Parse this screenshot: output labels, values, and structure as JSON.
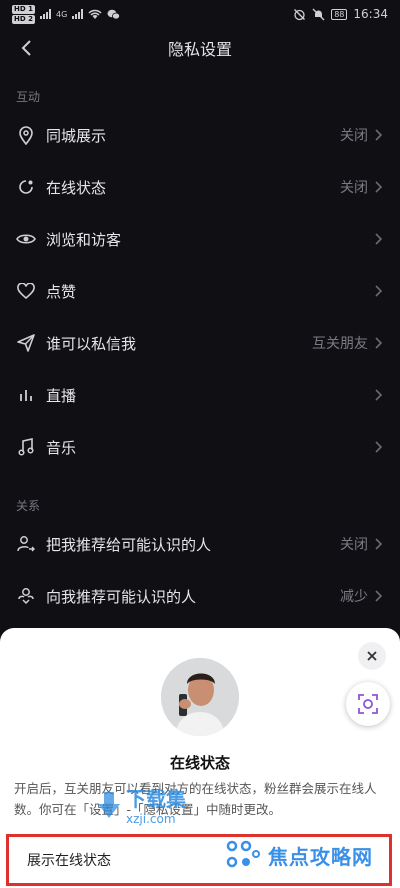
{
  "status_bar": {
    "hd1": "HD 1",
    "hd2": "HD 2",
    "net": "4G",
    "battery": "88",
    "time": "16:34"
  },
  "nav": {
    "title": "隐私设置"
  },
  "sections": {
    "interaction": "互动",
    "relations": "关系"
  },
  "rows": [
    {
      "label": "同城展示",
      "value": "关闭"
    },
    {
      "label": "在线状态",
      "value": "关闭"
    },
    {
      "label": "浏览和访客",
      "value": ""
    },
    {
      "label": "点赞",
      "value": ""
    },
    {
      "label": "谁可以私信我",
      "value": "互关朋友"
    },
    {
      "label": "直播",
      "value": ""
    },
    {
      "label": "音乐",
      "value": ""
    },
    {
      "label": "把我推荐给可能认识的人",
      "value": "关闭"
    },
    {
      "label": "向我推荐可能认识的人",
      "value": "减少"
    }
  ],
  "sheet": {
    "title": "在线状态",
    "description": "开启后，互关朋友可以看到对方的在线状态，粉丝群会展示在线人数。你可在「设置」-「隐私设置」中随时更改。",
    "option_label": "展示在线状态"
  },
  "watermarks": {
    "site1_name": "下载集",
    "site1_url": "xzji.com",
    "site2_name": "焦点攻略网"
  },
  "colors": {
    "background": "#101014",
    "sheet": "#ffffff",
    "highlight_border": "#e0302e",
    "watermark": "#2a8be0"
  }
}
